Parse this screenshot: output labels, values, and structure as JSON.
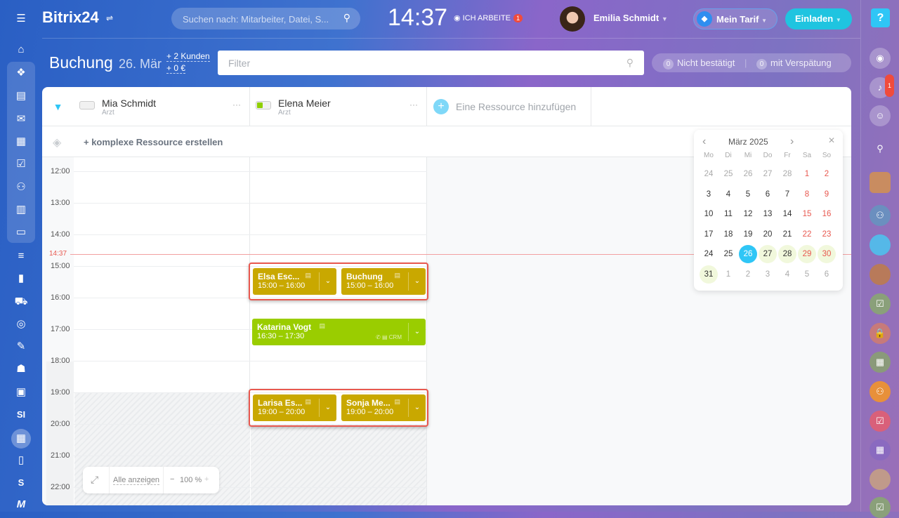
{
  "topbar": {
    "logo": "Bitrix24",
    "search_placeholder": "Suchen nach: Mitarbeiter, Datei, S...",
    "clock": "14:37",
    "work_status": "ICH ARBEITE",
    "work_badge": "1",
    "user_name": "Emilia Schmidt",
    "tarif": "Mein Tarif",
    "invite": "Einladen"
  },
  "header": {
    "title": "Buchung",
    "date": "26. Mär",
    "kunden": "+ 2 Kunden",
    "umsatz": "+ 0 €",
    "filter_placeholder": "Filter",
    "unconfirmed_count": "0",
    "unconfirmed_label": "Nicht bestätigt",
    "late_count": "0",
    "late_label": "mit Verspätung"
  },
  "resources": [
    {
      "name": "Mia Schmidt",
      "role": "Arzt"
    },
    {
      "name": "Elena Meier",
      "role": "Arzt"
    }
  ],
  "add_resource": "Eine Ressource hinzufügen",
  "complex_resource": "+ komplexe Ressource erstellen",
  "hours": [
    "12:00",
    "13:00",
    "14:00",
    "15:00",
    "16:00",
    "17:00",
    "18:00",
    "19:00",
    "20:00",
    "21:00",
    "22:00"
  ],
  "now_label": "14:37",
  "events": [
    {
      "title": "Elsa Esc...",
      "time": "15:00 – 16:00",
      "color": "#c9a800"
    },
    {
      "title": "Buchung",
      "time": "15:00 – 16:00",
      "color": "#c9a800"
    },
    {
      "title": "Katarina Vogt",
      "time": "16:30 – 17:30",
      "color": "#9acd00",
      "crm": "CRM"
    },
    {
      "title": "Larisa Es...",
      "time": "19:00 – 20:00",
      "color": "#c9a800"
    },
    {
      "title": "Sonja Me...",
      "time": "19:00 – 20:00",
      "color": "#c9a800"
    }
  ],
  "calendar": {
    "title": "März 2025",
    "weekdays": [
      "Mo",
      "Di",
      "Mi",
      "Do",
      "Fr",
      "Sa",
      "So"
    ],
    "days": [
      "24",
      "25",
      "26",
      "27",
      "28",
      "1",
      "2",
      "3",
      "4",
      "5",
      "6",
      "7",
      "8",
      "9",
      "10",
      "11",
      "12",
      "13",
      "14",
      "15",
      "16",
      "17",
      "18",
      "19",
      "20",
      "21",
      "22",
      "23",
      "24",
      "25",
      "26",
      "27",
      "28",
      "29",
      "30",
      "31",
      "1",
      "2",
      "3",
      "4",
      "5",
      "6"
    ],
    "selected_index": 30,
    "highlight_indices": [
      31,
      32,
      33,
      34,
      35
    ]
  },
  "zoom": {
    "show_all": "Alle anzeigen",
    "minus": "−",
    "level": "100 %",
    "plus": "+"
  },
  "sidebar_left": {
    "label_si": "SI",
    "label_s": "S"
  },
  "notifications_badge": "1"
}
